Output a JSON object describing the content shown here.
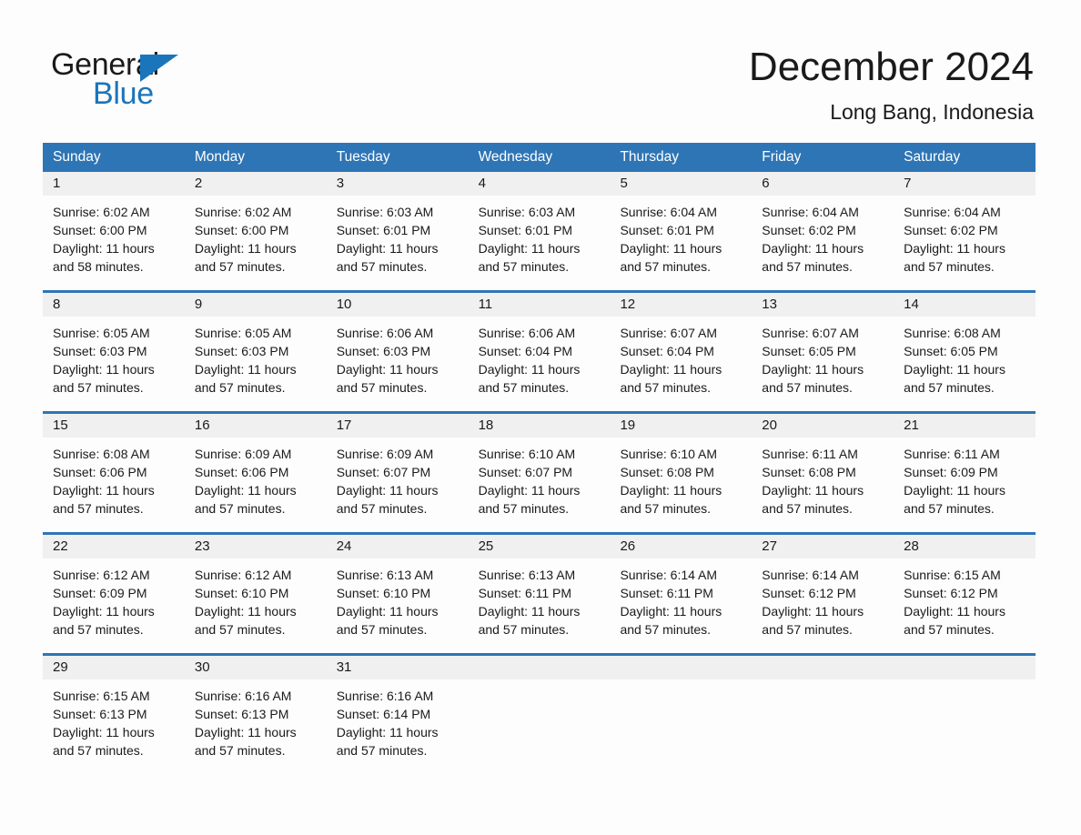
{
  "brand": {
    "name_part1": "General",
    "name_part2": "Blue",
    "triangle_color": "#1b75bb",
    "text_color": "#1a1a1a"
  },
  "header": {
    "title": "December 2024",
    "location": "Long Bang, Indonesia"
  },
  "theme": {
    "header_blue": "#2e75b6",
    "daynum_bg": "#f0f0f0",
    "page_bg": "#fdfdfd"
  },
  "calendar": {
    "weekdays": [
      "Sunday",
      "Monday",
      "Tuesday",
      "Wednesday",
      "Thursday",
      "Friday",
      "Saturday"
    ],
    "weeks": [
      {
        "days": [
          {
            "num": "1",
            "sunrise": "Sunrise: 6:02 AM",
            "sunset": "Sunset: 6:00 PM",
            "daylight1": "Daylight: 11 hours",
            "daylight2": "and 58 minutes."
          },
          {
            "num": "2",
            "sunrise": "Sunrise: 6:02 AM",
            "sunset": "Sunset: 6:00 PM",
            "daylight1": "Daylight: 11 hours",
            "daylight2": "and 57 minutes."
          },
          {
            "num": "3",
            "sunrise": "Sunrise: 6:03 AM",
            "sunset": "Sunset: 6:01 PM",
            "daylight1": "Daylight: 11 hours",
            "daylight2": "and 57 minutes."
          },
          {
            "num": "4",
            "sunrise": "Sunrise: 6:03 AM",
            "sunset": "Sunset: 6:01 PM",
            "daylight1": "Daylight: 11 hours",
            "daylight2": "and 57 minutes."
          },
          {
            "num": "5",
            "sunrise": "Sunrise: 6:04 AM",
            "sunset": "Sunset: 6:01 PM",
            "daylight1": "Daylight: 11 hours",
            "daylight2": "and 57 minutes."
          },
          {
            "num": "6",
            "sunrise": "Sunrise: 6:04 AM",
            "sunset": "Sunset: 6:02 PM",
            "daylight1": "Daylight: 11 hours",
            "daylight2": "and 57 minutes."
          },
          {
            "num": "7",
            "sunrise": "Sunrise: 6:04 AM",
            "sunset": "Sunset: 6:02 PM",
            "daylight1": "Daylight: 11 hours",
            "daylight2": "and 57 minutes."
          }
        ]
      },
      {
        "days": [
          {
            "num": "8",
            "sunrise": "Sunrise: 6:05 AM",
            "sunset": "Sunset: 6:03 PM",
            "daylight1": "Daylight: 11 hours",
            "daylight2": "and 57 minutes."
          },
          {
            "num": "9",
            "sunrise": "Sunrise: 6:05 AM",
            "sunset": "Sunset: 6:03 PM",
            "daylight1": "Daylight: 11 hours",
            "daylight2": "and 57 minutes."
          },
          {
            "num": "10",
            "sunrise": "Sunrise: 6:06 AM",
            "sunset": "Sunset: 6:03 PM",
            "daylight1": "Daylight: 11 hours",
            "daylight2": "and 57 minutes."
          },
          {
            "num": "11",
            "sunrise": "Sunrise: 6:06 AM",
            "sunset": "Sunset: 6:04 PM",
            "daylight1": "Daylight: 11 hours",
            "daylight2": "and 57 minutes."
          },
          {
            "num": "12",
            "sunrise": "Sunrise: 6:07 AM",
            "sunset": "Sunset: 6:04 PM",
            "daylight1": "Daylight: 11 hours",
            "daylight2": "and 57 minutes."
          },
          {
            "num": "13",
            "sunrise": "Sunrise: 6:07 AM",
            "sunset": "Sunset: 6:05 PM",
            "daylight1": "Daylight: 11 hours",
            "daylight2": "and 57 minutes."
          },
          {
            "num": "14",
            "sunrise": "Sunrise: 6:08 AM",
            "sunset": "Sunset: 6:05 PM",
            "daylight1": "Daylight: 11 hours",
            "daylight2": "and 57 minutes."
          }
        ]
      },
      {
        "days": [
          {
            "num": "15",
            "sunrise": "Sunrise: 6:08 AM",
            "sunset": "Sunset: 6:06 PM",
            "daylight1": "Daylight: 11 hours",
            "daylight2": "and 57 minutes."
          },
          {
            "num": "16",
            "sunrise": "Sunrise: 6:09 AM",
            "sunset": "Sunset: 6:06 PM",
            "daylight1": "Daylight: 11 hours",
            "daylight2": "and 57 minutes."
          },
          {
            "num": "17",
            "sunrise": "Sunrise: 6:09 AM",
            "sunset": "Sunset: 6:07 PM",
            "daylight1": "Daylight: 11 hours",
            "daylight2": "and 57 minutes."
          },
          {
            "num": "18",
            "sunrise": "Sunrise: 6:10 AM",
            "sunset": "Sunset: 6:07 PM",
            "daylight1": "Daylight: 11 hours",
            "daylight2": "and 57 minutes."
          },
          {
            "num": "19",
            "sunrise": "Sunrise: 6:10 AM",
            "sunset": "Sunset: 6:08 PM",
            "daylight1": "Daylight: 11 hours",
            "daylight2": "and 57 minutes."
          },
          {
            "num": "20",
            "sunrise": "Sunrise: 6:11 AM",
            "sunset": "Sunset: 6:08 PM",
            "daylight1": "Daylight: 11 hours",
            "daylight2": "and 57 minutes."
          },
          {
            "num": "21",
            "sunrise": "Sunrise: 6:11 AM",
            "sunset": "Sunset: 6:09 PM",
            "daylight1": "Daylight: 11 hours",
            "daylight2": "and 57 minutes."
          }
        ]
      },
      {
        "days": [
          {
            "num": "22",
            "sunrise": "Sunrise: 6:12 AM",
            "sunset": "Sunset: 6:09 PM",
            "daylight1": "Daylight: 11 hours",
            "daylight2": "and 57 minutes."
          },
          {
            "num": "23",
            "sunrise": "Sunrise: 6:12 AM",
            "sunset": "Sunset: 6:10 PM",
            "daylight1": "Daylight: 11 hours",
            "daylight2": "and 57 minutes."
          },
          {
            "num": "24",
            "sunrise": "Sunrise: 6:13 AM",
            "sunset": "Sunset: 6:10 PM",
            "daylight1": "Daylight: 11 hours",
            "daylight2": "and 57 minutes."
          },
          {
            "num": "25",
            "sunrise": "Sunrise: 6:13 AM",
            "sunset": "Sunset: 6:11 PM",
            "daylight1": "Daylight: 11 hours",
            "daylight2": "and 57 minutes."
          },
          {
            "num": "26",
            "sunrise": "Sunrise: 6:14 AM",
            "sunset": "Sunset: 6:11 PM",
            "daylight1": "Daylight: 11 hours",
            "daylight2": "and 57 minutes."
          },
          {
            "num": "27",
            "sunrise": "Sunrise: 6:14 AM",
            "sunset": "Sunset: 6:12 PM",
            "daylight1": "Daylight: 11 hours",
            "daylight2": "and 57 minutes."
          },
          {
            "num": "28",
            "sunrise": "Sunrise: 6:15 AM",
            "sunset": "Sunset: 6:12 PM",
            "daylight1": "Daylight: 11 hours",
            "daylight2": "and 57 minutes."
          }
        ]
      },
      {
        "days": [
          {
            "num": "29",
            "sunrise": "Sunrise: 6:15 AM",
            "sunset": "Sunset: 6:13 PM",
            "daylight1": "Daylight: 11 hours",
            "daylight2": "and 57 minutes."
          },
          {
            "num": "30",
            "sunrise": "Sunrise: 6:16 AM",
            "sunset": "Sunset: 6:13 PM",
            "daylight1": "Daylight: 11 hours",
            "daylight2": "and 57 minutes."
          },
          {
            "num": "31",
            "sunrise": "Sunrise: 6:16 AM",
            "sunset": "Sunset: 6:14 PM",
            "daylight1": "Daylight: 11 hours",
            "daylight2": "and 57 minutes."
          },
          {
            "num": "",
            "sunrise": "",
            "sunset": "",
            "daylight1": "",
            "daylight2": ""
          },
          {
            "num": "",
            "sunrise": "",
            "sunset": "",
            "daylight1": "",
            "daylight2": ""
          },
          {
            "num": "",
            "sunrise": "",
            "sunset": "",
            "daylight1": "",
            "daylight2": ""
          },
          {
            "num": "",
            "sunrise": "",
            "sunset": "",
            "daylight1": "",
            "daylight2": ""
          }
        ]
      }
    ]
  }
}
